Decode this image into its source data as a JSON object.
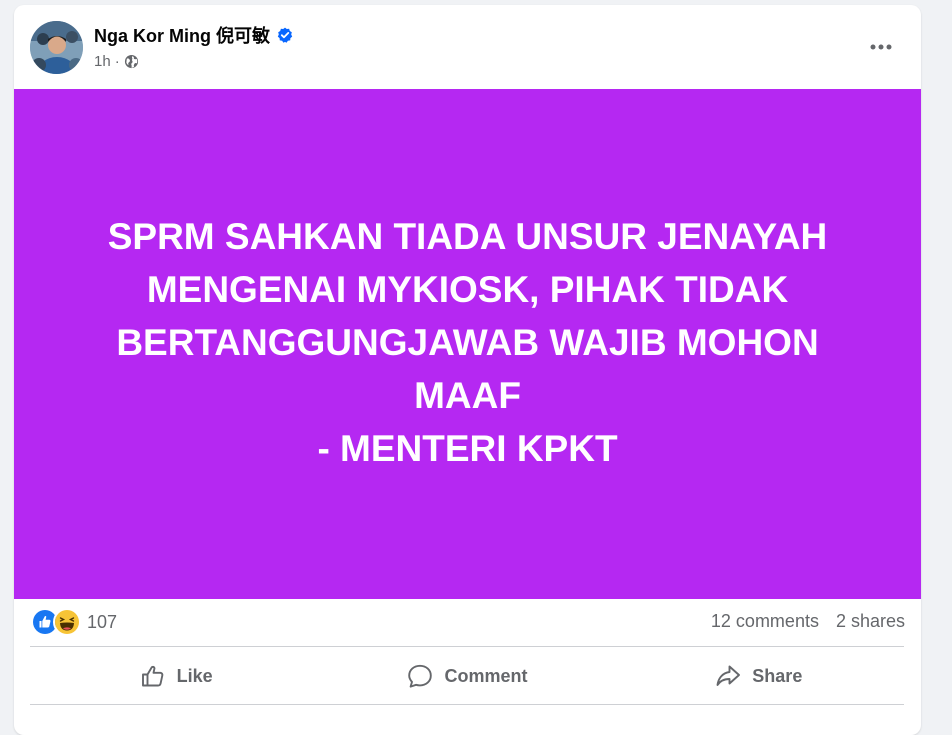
{
  "post": {
    "author": "Nga Kor Ming 倪可敏",
    "time": "1h",
    "separator": "·",
    "image_text_lines": [
      "SPRM SAHKAN TIADA UNSUR JENAYAH",
      "MENGENAI MYKIOSK, PIHAK TIDAK",
      "BERTANGGUNGJAWAB WAJIB MOHON",
      "MAAF",
      "- MENTERI KPKT"
    ],
    "image_background": "#b528f2",
    "reaction_count": "107",
    "comments": "12 comments",
    "shares": "2 shares",
    "reactions": [
      "like-icon",
      "haha-icon"
    ]
  },
  "actions": {
    "like": "Like",
    "comment": "Comment",
    "share": "Share"
  }
}
